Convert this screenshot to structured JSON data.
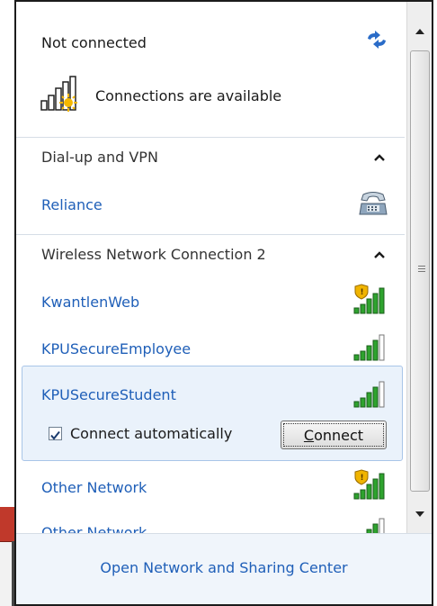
{
  "status": {
    "title": "Not connected",
    "message": "Connections are available"
  },
  "sections": [
    {
      "label": "Dial-up and VPN"
    },
    {
      "label": "Wireless Network Connection 2"
    }
  ],
  "dialup": {
    "items": [
      {
        "label": "Reliance",
        "icon": "telephone-modem-icon"
      }
    ]
  },
  "wireless": {
    "networks": [
      {
        "label": "KwantlenWeb",
        "secured": false
      },
      {
        "label": "KPUSecureEmployee",
        "secured": true
      },
      {
        "label": "KPUSecureStudent",
        "secured": true,
        "selected": true
      },
      {
        "label": "Other Network",
        "secured": false
      },
      {
        "label": "Other Network",
        "secured": true
      }
    ],
    "connect_automatically": "Connect automatically",
    "connect_automatically_checked": true,
    "connect_button": "Connect",
    "connect_button_access_key": "C"
  },
  "footer": {
    "link": "Open Network and Sharing Center"
  },
  "colors": {
    "link": "#1f5fb8",
    "selection_bg": "#eaf2fb",
    "selection_border": "#a9c5e8",
    "footer_bg": "#f0f5fb"
  }
}
